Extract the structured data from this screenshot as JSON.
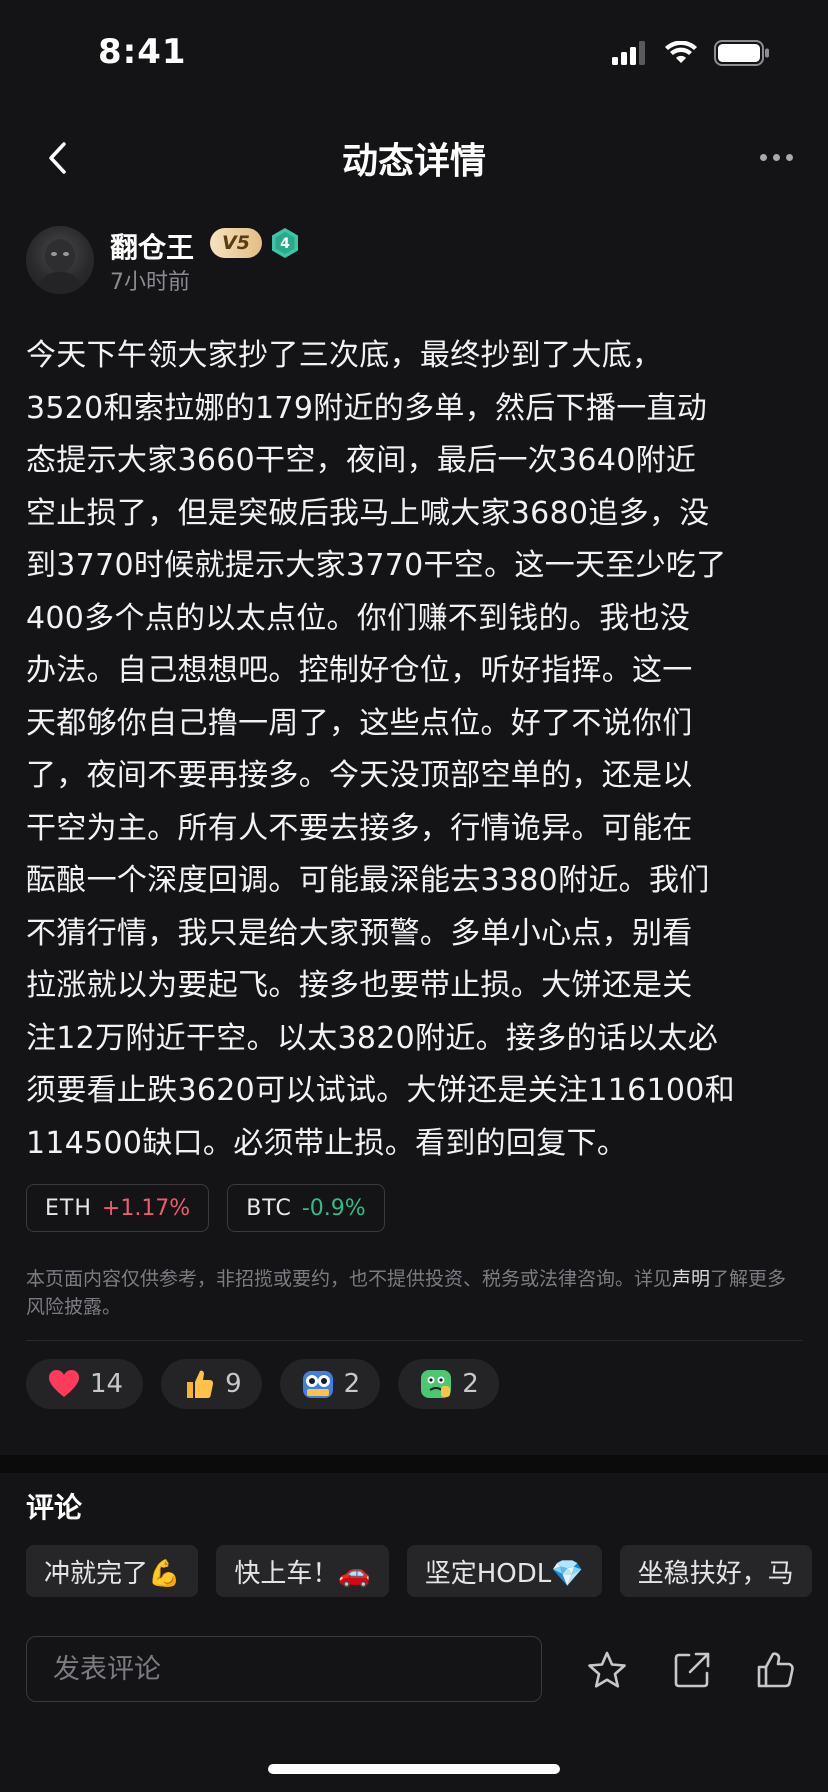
{
  "status_bar": {
    "time": "8:41"
  },
  "nav": {
    "title": "动态详情"
  },
  "post": {
    "author": "翻仓王",
    "vip_badge": "V5",
    "level_badge": "4",
    "time": "7小时前",
    "lines": [
      "今天下午领大家抄了三次底，最终抄到了大底，",
      "3520和索拉娜的179附近的多单，然后下播一直动",
      "态提示大家3660干空，夜间，最后一次3640附近",
      "空止损了，但是突破后我马上喊大家3680追多，没",
      "到3770时候就提示大家3770干空。这一天至少吃了",
      "400多个点的以太点位。你们赚不到钱的。我也没",
      "办法。自己想想吧。控制好仓位，听好指挥。这一",
      "天都够你自己撸一周了，这些点位。好了不说你们",
      "了，夜间不要再接多。今天没顶部空单的，还是以",
      "干空为主。所有人不要去接多，行情诡异。可能在",
      "酝酿一个深度回调。可能最深能去3380附近。我们",
      "不猜行情，我只是给大家预警。多单小心点，别看",
      "拉涨就以为要起飞。接多也要带止损。大饼还是关",
      "注12万附近干空。以太3820附近。接多的话以太必",
      "须要看止跌3620可以试试。大饼还是关注116100和",
      "114500缺口。必须带止损。看到的回复下。"
    ]
  },
  "tickers": [
    {
      "symbol": "ETH",
      "change": "+1.17%",
      "direction": "up"
    },
    {
      "symbol": "BTC",
      "change": "-0.9%",
      "direction": "down"
    }
  ],
  "disclaimer": {
    "text_before": "本页面内容仅供参考，非招揽或要约，也不提供投资、税务或法律咨询。详见",
    "link": "声明",
    "text_after": "了解更多风险披露。"
  },
  "reactions": [
    {
      "icon": "heart-icon",
      "count": "14"
    },
    {
      "icon": "thumbs-up-icon",
      "count": "9"
    },
    {
      "icon": "hodl-owl-icon",
      "count": "2"
    },
    {
      "icon": "green-face-icon",
      "count": "2"
    }
  ],
  "comments": {
    "title": "评论",
    "quick_replies": [
      "冲就完了💪",
      "快上车！🚗",
      "坚定HODL💎",
      "坐稳扶好，马"
    ],
    "composer_placeholder": "发表评论"
  },
  "colors": {
    "background": "#141416",
    "up": "#f05a6e",
    "down": "#2ebd85",
    "vip_gold": "#e2be86",
    "level_teal": "#3cc6a6"
  }
}
